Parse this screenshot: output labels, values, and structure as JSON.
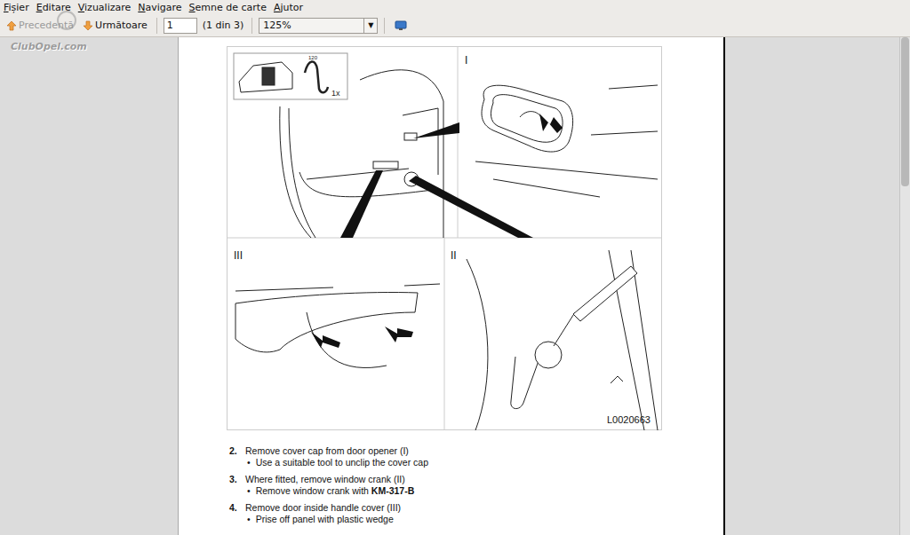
{
  "menu": [
    {
      "label": "Fișier"
    },
    {
      "label": "Editare"
    },
    {
      "label": "Vizualizare"
    },
    {
      "label": "Navigare"
    },
    {
      "label": "Semne de carte"
    },
    {
      "label": "Ajutor"
    }
  ],
  "toolbar": {
    "previous": {
      "label": "Precedentă",
      "disabled": true
    },
    "next": {
      "label": "Următoare",
      "disabled": false
    },
    "page_field": "1",
    "page_count": "(1 din 3)",
    "zoom": "125%",
    "zoom_arrow": "▼"
  },
  "watermark": "ClubOpel.com",
  "scrollbar": {
    "level": 0.3
  },
  "document": {
    "figure": {
      "inset_part_number": "120",
      "inset_quantity": "1x",
      "panels": [
        {
          "label": "I"
        },
        {
          "label": "III"
        },
        {
          "label": "II"
        }
      ],
      "code": "L0020663"
    },
    "steps": [
      {
        "number": "2.",
        "text": "Remove cover cap from door opener (I)",
        "bullets": [
          [
            {
              "text": "Use a suitable tool to unclip the cover cap",
              "bold": false
            }
          ]
        ]
      },
      {
        "number": "3.",
        "text": "Where fitted, remove window crank (II)",
        "bullets": [
          [
            {
              "text": "Remove window crank with ",
              "bold": false
            },
            {
              "text": "KM-317-B",
              "bold": true
            }
          ]
        ]
      },
      {
        "number": "4.",
        "text": "Remove door inside handle cover (III)",
        "bullets": [
          [
            {
              "text": "Prise off panel with plastic wedge",
              "bold": false
            }
          ]
        ]
      }
    ],
    "bullet_mark": "•"
  }
}
